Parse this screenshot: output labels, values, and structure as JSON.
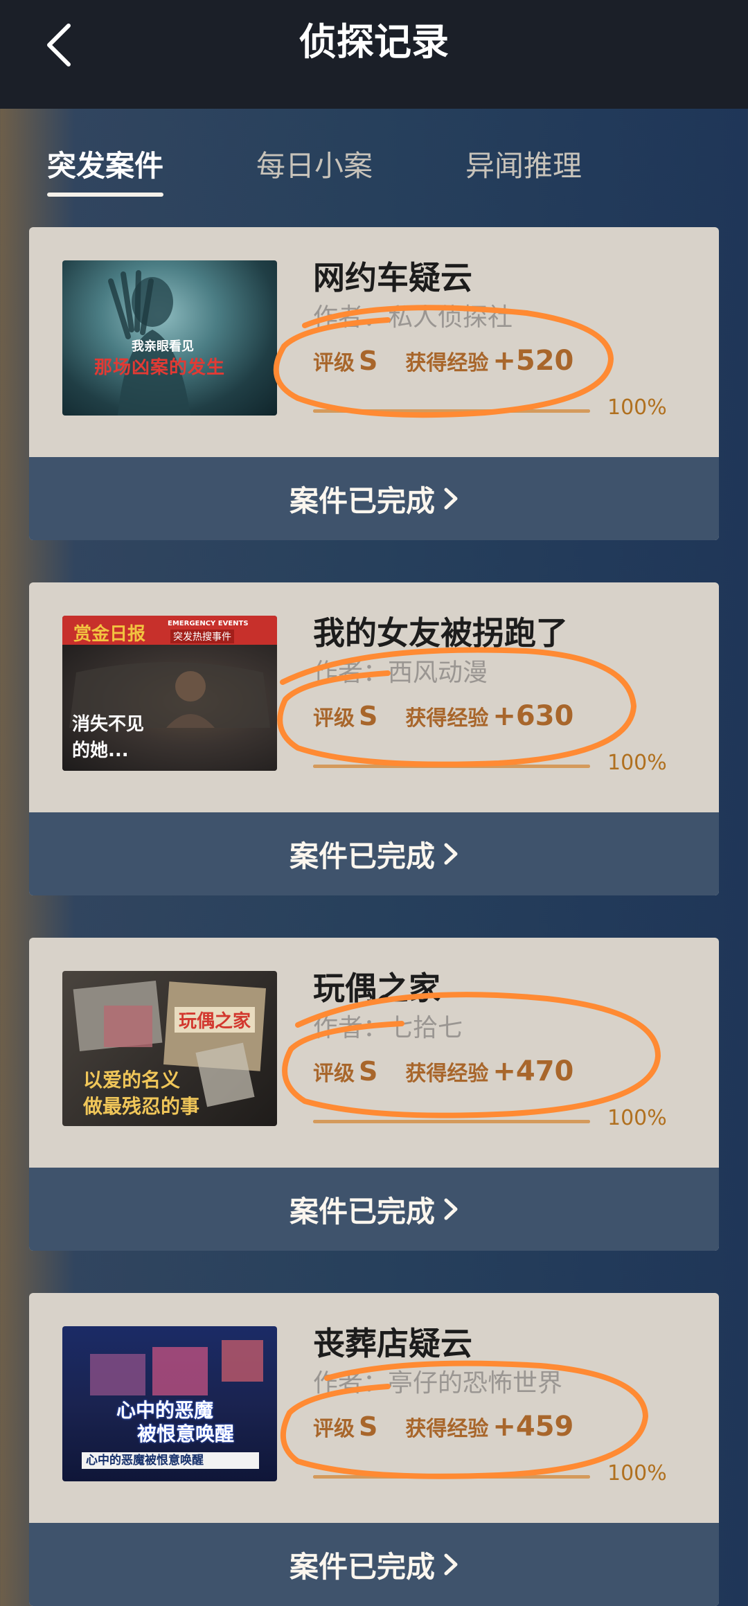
{
  "header": {
    "title": "侦探记录"
  },
  "tabs": [
    {
      "label": "突发案件",
      "active": true
    },
    {
      "label": "每日小案",
      "active": false
    },
    {
      "label": "异闻推理",
      "active": false
    }
  ],
  "cards": [
    {
      "title": "网约车疑云",
      "author": "作者：私人侦探社",
      "rating_label": "评级",
      "rating": "S",
      "exp_label": "获得经验",
      "exp": "+520",
      "progress": 1.0,
      "percent": "100%",
      "status": "案件已完成",
      "thumb_text_1": "我亲眼看见",
      "thumb_text_2": "那场凶案的发生"
    },
    {
      "title": "我的女友被拐跑了",
      "author": "作者：西风动漫",
      "rating_label": "评级",
      "rating": "S",
      "exp_label": "获得经验",
      "exp": "+630",
      "progress": 1.0,
      "percent": "100%",
      "status": "案件已完成",
      "thumb_text_1": "赏金日报",
      "thumb_text_2": "EMERGENCY EVENTS",
      "thumb_text_3": "突发热搜事件",
      "thumb_text_4": "消失不见",
      "thumb_text_5": "的她..."
    },
    {
      "title": "玩偶之家",
      "author": "作者：七拾七",
      "rating_label": "评级",
      "rating": "S",
      "exp_label": "获得经验",
      "exp": "+470",
      "progress": 1.0,
      "percent": "100%",
      "status": "案件已完成",
      "thumb_text_1": "玩偶之家",
      "thumb_text_2": "以爱的名义",
      "thumb_text_3": "做最残忍的事"
    },
    {
      "title": "丧葬店疑云",
      "author": "作者：亭仔的恐怖世界",
      "rating_label": "评级",
      "rating": "S",
      "exp_label": "获得经验",
      "exp": "+459",
      "progress": 1.0,
      "percent": "100%",
      "status": "案件已完成",
      "thumb_text_1": "心中的恶魔",
      "thumb_text_2": "被恨意唤醒",
      "thumb_text_3": "心中的恶魔被恨意唤醒"
    }
  ],
  "colors": {
    "accent": "#a8662b",
    "annotation": "#ff8a33",
    "card_bg": "#d8d2c9",
    "card_footer": "#3f536c"
  }
}
